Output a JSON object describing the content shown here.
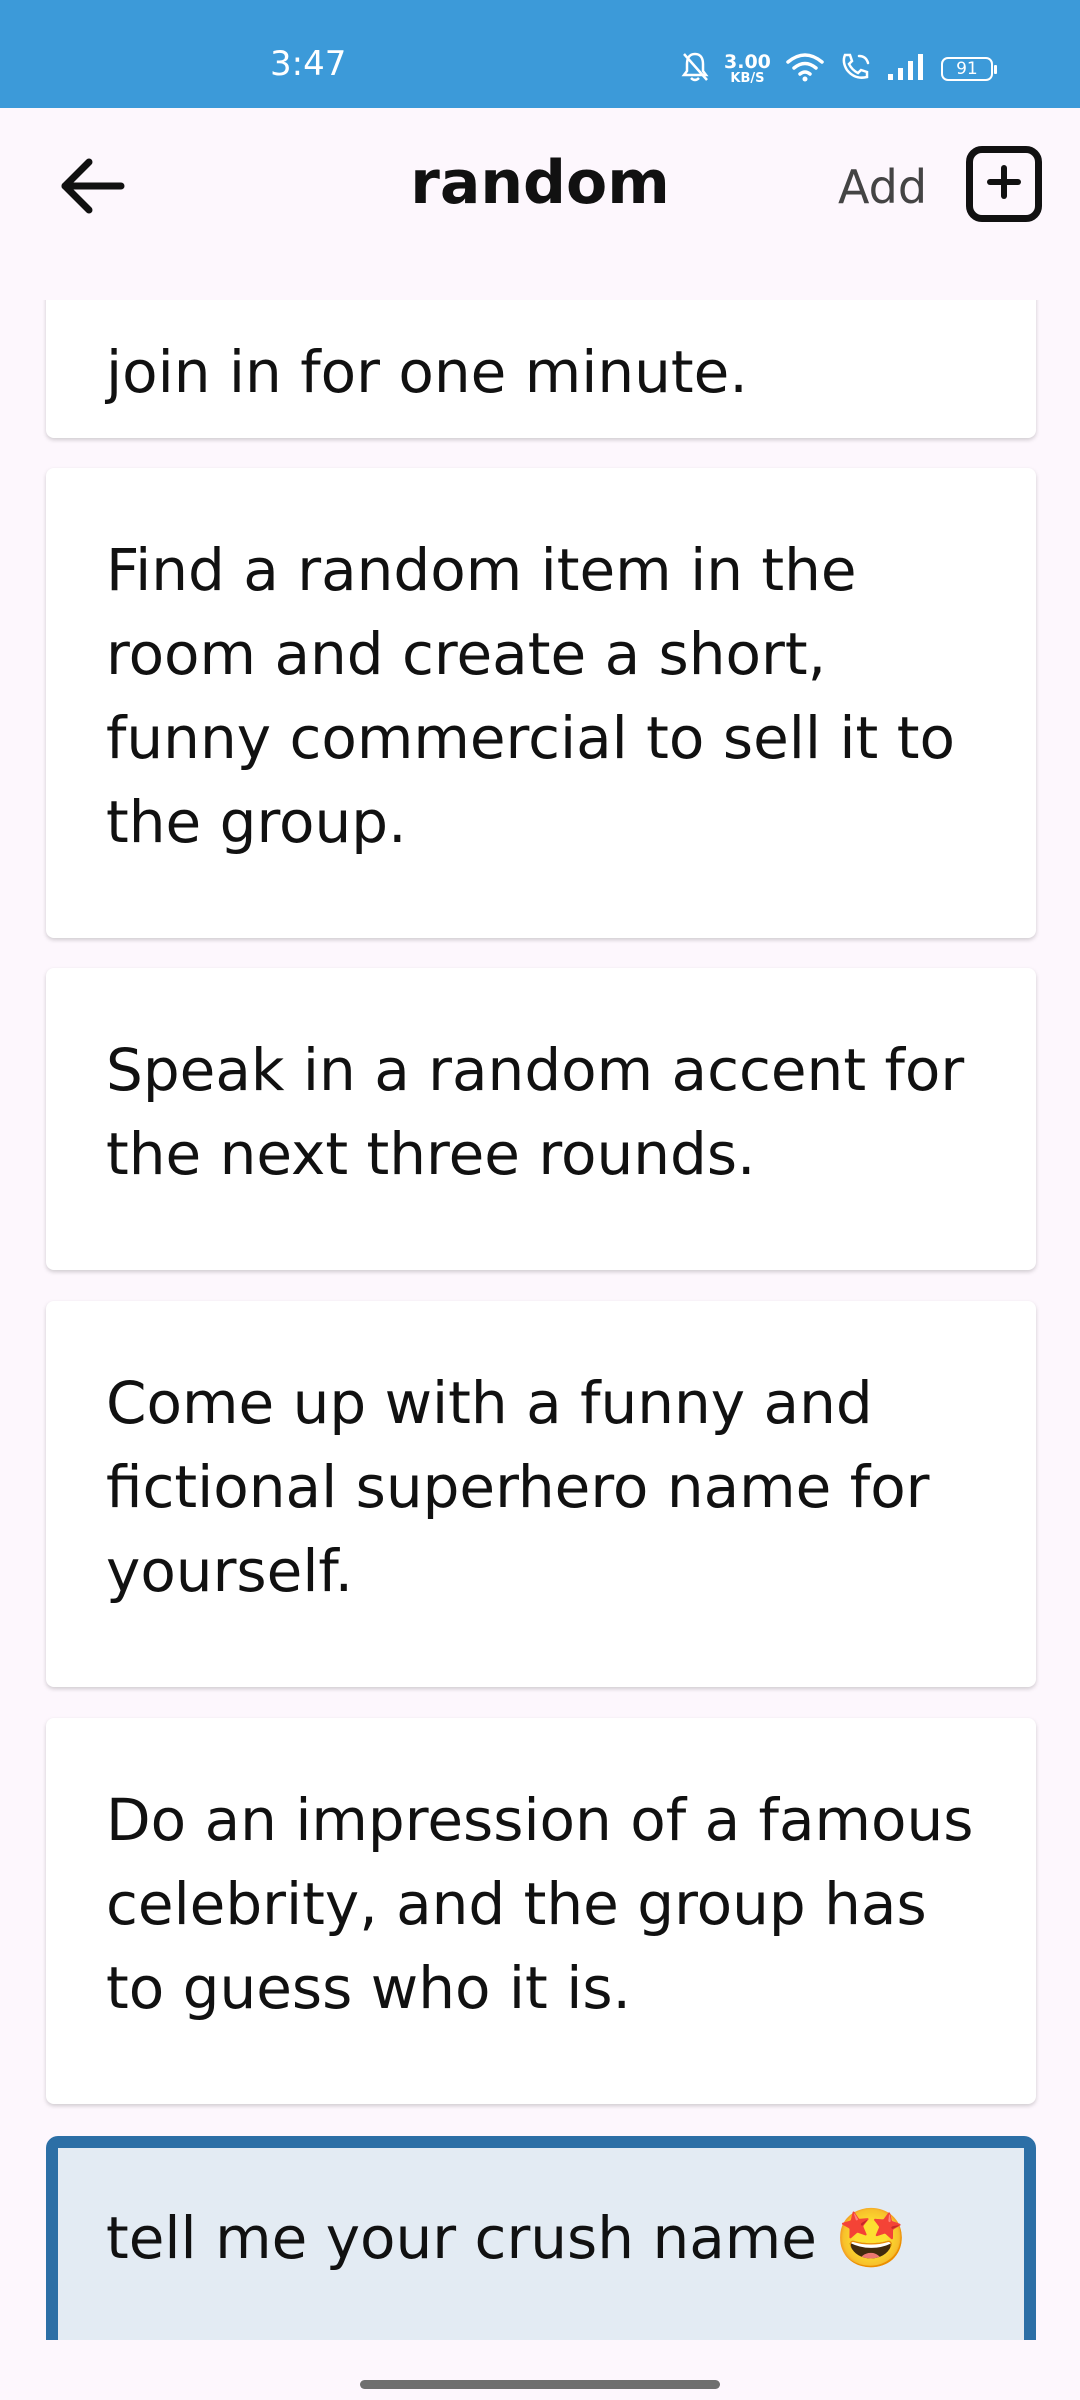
{
  "status_bar": {
    "time": "3:47",
    "net_speed_value": "3.00",
    "net_speed_unit": "KB/S",
    "battery": "91",
    "icons": [
      "silent-bell-icon",
      "wifi-icon",
      "wifi-calling-icon",
      "cell-signal-icon",
      "battery-icon"
    ]
  },
  "app_bar": {
    "title": "random",
    "add_label": "Add",
    "back_icon": "arrow-left-icon",
    "add_icon": "plus-square-icon"
  },
  "cards": [
    {
      "text": "join in for one minute."
    },
    {
      "text": "Find a random item in the room and create a short, funny commercial to sell it to the group."
    },
    {
      "text": "Speak in a random accent for the next three rounds."
    },
    {
      "text": "Come up with a funny and fictional superhero name for yourself."
    },
    {
      "text": "Do an impression of a famous celebrity, and the group has to guess who it is."
    },
    {
      "text": "tell me your crush name 🤩",
      "selected": true
    }
  ],
  "colors": {
    "status_bar": "#3c9ad9",
    "background": "#fdf7fd",
    "selected_border": "#2c6fa6",
    "selected_fill": "#e3ebf3"
  }
}
